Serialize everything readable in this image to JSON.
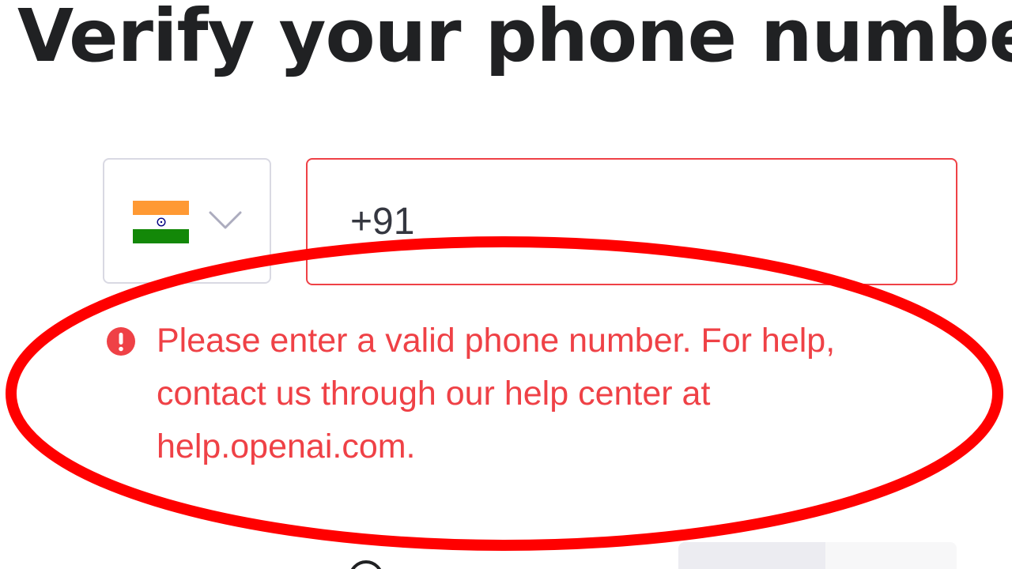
{
  "page": {
    "title": "Verify your phone numbe"
  },
  "country_selector": {
    "selected_country_icon": "india-flag-icon",
    "dropdown_icon": "chevron-down-icon",
    "flag_colors": {
      "top": "#ff9933",
      "middle": "#ffffff",
      "bottom": "#138808",
      "chakra": "#000080"
    }
  },
  "phone_input": {
    "value": "+91",
    "border_color": "#ef4146"
  },
  "error": {
    "icon": "exclamation-circle-icon",
    "message": "Please enter a valid phone number. For help, contact us through our help center at help.openai.com.",
    "color": "#ef4146"
  },
  "annotation": {
    "shape": "ellipse",
    "color": "#ff0000"
  },
  "colors": {
    "text": "#202123",
    "border": "#d9d9e3"
  }
}
